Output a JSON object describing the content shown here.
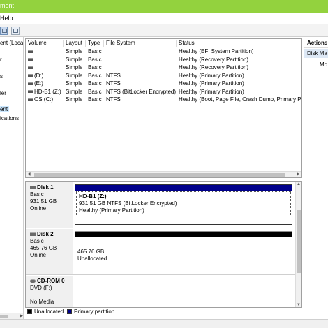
{
  "window": {
    "title_fragment": "ment",
    "accent_color": "#93d23e"
  },
  "menubar": {
    "help_label": "Help"
  },
  "tree": {
    "items": [
      {
        "label": "ent (Local",
        "selected": false
      },
      {
        "label": "r",
        "selected": false
      },
      {
        "label": "s",
        "selected": false
      },
      {
        "label": "ler",
        "selected": false
      },
      {
        "label": "ent",
        "selected": true
      },
      {
        "label": "ications",
        "selected": false
      }
    ]
  },
  "volumes": {
    "columns": [
      "Volume",
      "Layout",
      "Type",
      "File System",
      "Status"
    ],
    "rows": [
      [
        "",
        "Simple",
        "Basic",
        "",
        "Healthy (EFI System Partition)"
      ],
      [
        "",
        "Simple",
        "Basic",
        "",
        "Healthy (Recovery Partition)"
      ],
      [
        "",
        "Simple",
        "Basic",
        "",
        "Healthy (Recovery Partition)"
      ],
      [
        "(D:)",
        "Simple",
        "Basic",
        "NTFS",
        "Healthy (Primary Partition)"
      ],
      [
        "(E:)",
        "Simple",
        "Basic",
        "NTFS",
        "Healthy (Primary Partition)"
      ],
      [
        "HD-B1 (Z:)",
        "Simple",
        "Basic",
        "NTFS (BitLocker Encrypted)",
        "Healthy (Primary Partition)"
      ],
      [
        "OS (C:)",
        "Simple",
        "Basic",
        "NTFS",
        "Healthy (Boot, Page File, Crash Dump, Primary Par"
      ]
    ]
  },
  "disks": [
    {
      "name": "Disk 1",
      "type": "Basic",
      "size": "931.51 GB",
      "state": "Online",
      "partition": {
        "name": "HD-B1  (Z:)",
        "line1": "931.51 GB NTFS (BitLocker Encrypted)",
        "line2": "Healthy (Primary Partition)",
        "bar_color": "#00008b"
      }
    },
    {
      "name": "Disk 2",
      "type": "Basic",
      "size": "465.76 GB",
      "state": "Online",
      "partition": {
        "name": "",
        "line1": "465.76 GB",
        "line2": "Unallocated",
        "bar_color": "#000000"
      }
    },
    {
      "name": "CD-ROM 0",
      "type": "DVD (F:)",
      "size": "",
      "state": "No Media"
    }
  ],
  "legend": {
    "unallocated": {
      "label": "Unallocated",
      "color": "#000000"
    },
    "primary": {
      "label": "Primary partition",
      "color": "#00008b"
    }
  },
  "actions": {
    "header": "Actions",
    "group": "Disk Ma",
    "item": "Mo"
  }
}
